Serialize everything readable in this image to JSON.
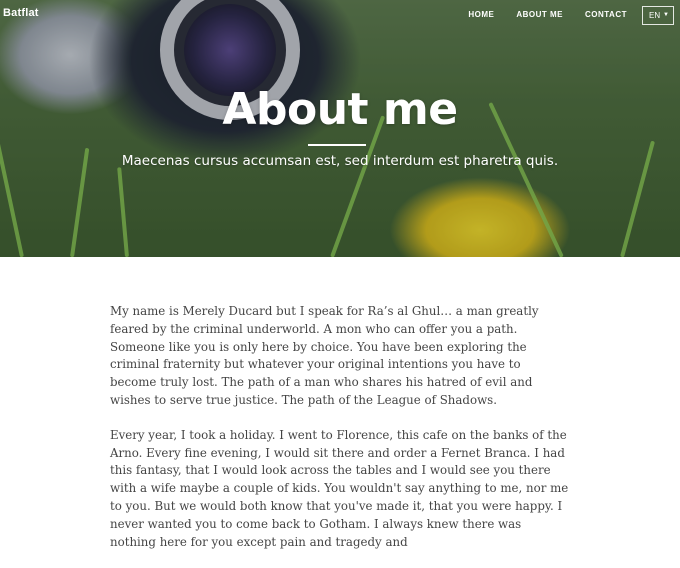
{
  "header": {
    "brand": "Batflat",
    "nav": [
      {
        "label": "HOME"
      },
      {
        "label": "ABOUT ME"
      },
      {
        "label": "CONTACT"
      }
    ],
    "language": {
      "selected": "EN",
      "icon": "chevron-down-icon"
    }
  },
  "hero": {
    "title": "About me",
    "subtitle": "Maecenas cursus accumsan est, sed interdum est pharetra quis."
  },
  "content": {
    "paragraphs": [
      "My name is Merely Ducard but I speak for Ra’s al Ghul… a man greatly feared by the criminal underworld. A mon who can offer you a path. Someone like you is only here by choice. You have been exploring the criminal fraternity but whatever your original intentions you have to become truly lost. The path of a man who shares his hatred of evil and wishes to serve true justice. The path of the League of Shadows.",
      "Every year, I took a holiday. I went to Florence, this cafe on the banks of the Arno. Every fine evening, I would sit there and order a Fernet Branca. I had this fantasy, that I would look across the tables and I would see you there with a wife maybe a couple of kids. You wouldn't say anything to me, nor me to you. But we would both know that you've made it, that you were happy. I never wanted you to come back to Gotham. I always knew there was nothing here for you except pain and tragedy and"
    ]
  }
}
